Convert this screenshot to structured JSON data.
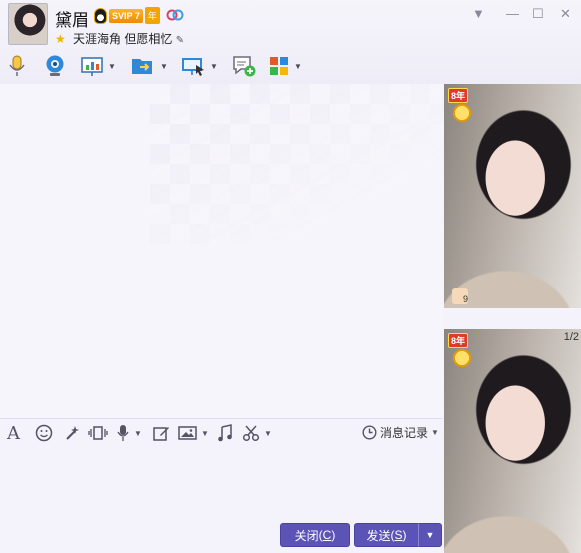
{
  "header": {
    "contact_name": "黛眉",
    "vip_label": "SVIP 7",
    "vip_year_label": "年",
    "signature": "天涯海角 但愿相忆",
    "colors": {
      "accent": "#5b53b6",
      "vip": "#f6a200"
    }
  },
  "toolbar": {
    "items": [
      {
        "name": "voice-call",
        "icon": "microphone-icon"
      },
      {
        "name": "video-call",
        "icon": "webcam-icon"
      },
      {
        "name": "remote-assist",
        "icon": "presentation-icon",
        "has_dropdown": true
      },
      {
        "name": "send-file",
        "icon": "folder-arrow-icon",
        "has_dropdown": true
      },
      {
        "name": "screen-share",
        "icon": "monitor-cursor-icon",
        "has_dropdown": true
      },
      {
        "name": "create-discussion",
        "icon": "chat-plus-icon"
      },
      {
        "name": "apps",
        "icon": "apps-grid-icon",
        "has_dropdown": true
      }
    ]
  },
  "input_toolbar": {
    "icons": [
      "font-icon",
      "emoji-icon",
      "magic-wand-icon",
      "screen-shake-icon",
      "voice-message-icon",
      "edit-icon",
      "image-icon",
      "music-icon",
      "scissors-icon"
    ],
    "history_label": "消息记录"
  },
  "buttons": {
    "close_label": "关闭",
    "close_key": "C",
    "send_label": "发送",
    "send_key": "S"
  },
  "side_panel": {
    "badge_top": "8年",
    "badge_bottom": "8年",
    "like_count": "9",
    "pager": "1/2"
  }
}
